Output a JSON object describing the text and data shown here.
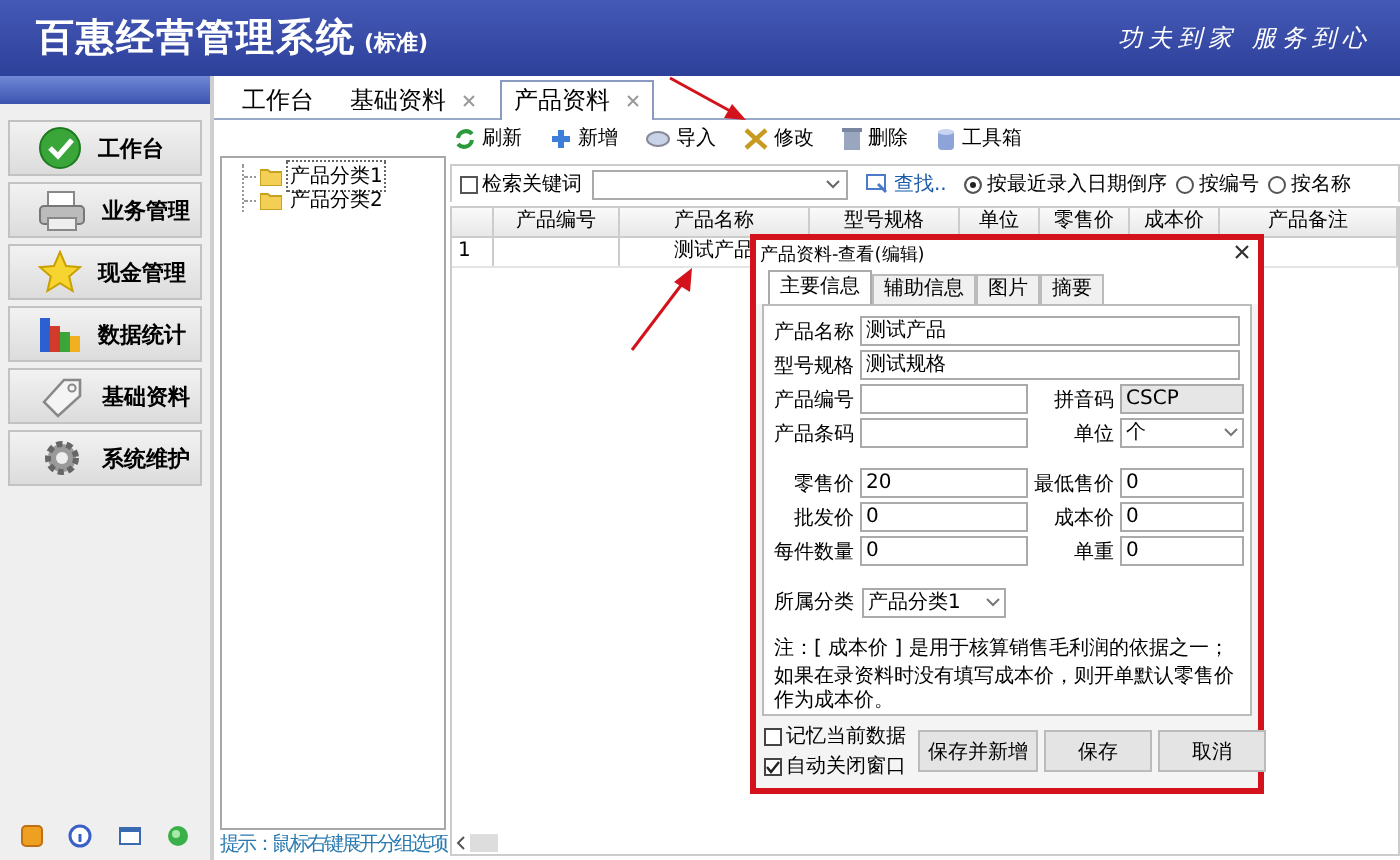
{
  "header": {
    "title": "百惠经营管理系统",
    "edition": "(标准)",
    "slogan": "功夫到家 服务到心"
  },
  "sidebar": {
    "items": [
      {
        "label": "工作台"
      },
      {
        "label": "业务管理"
      },
      {
        "label": "现金管理"
      },
      {
        "label": "数据统计"
      },
      {
        "label": "基础资料"
      },
      {
        "label": "系统维护"
      }
    ]
  },
  "tabs": [
    {
      "label": "工作台",
      "selected": false,
      "closable": false
    },
    {
      "label": "基础资料",
      "selected": false,
      "closable": true
    },
    {
      "label": "产品资料",
      "selected": true,
      "closable": true
    }
  ],
  "toolbar": [
    "刷新",
    "新增",
    "导入",
    "修改",
    "删除",
    "工具箱"
  ],
  "tree": {
    "items": [
      {
        "label": "产品分类1",
        "selected": true
      },
      {
        "label": "产品分类2",
        "selected": false
      }
    ],
    "hint": "提示：鼠标右键展开分组选项"
  },
  "search": {
    "label": "检索关键词",
    "checked": false,
    "find": "查找..",
    "sort_options": [
      {
        "label": "按最近录入日期倒序",
        "selected": true
      },
      {
        "label": "按编号",
        "selected": false
      },
      {
        "label": "按名称",
        "selected": false
      }
    ]
  },
  "table": {
    "columns": [
      "产品编号",
      "产品名称",
      "型号规格",
      "单位",
      "零售价",
      "成本价",
      "产品备注"
    ],
    "rows": [
      {
        "index": "1",
        "product_name": "测试产品"
      }
    ]
  },
  "dialog": {
    "title": "产品资料-查看(编辑)",
    "tabs": [
      {
        "label": "主要信息",
        "selected": true
      },
      {
        "label": "辅助信息",
        "selected": false
      },
      {
        "label": "图片",
        "selected": false
      },
      {
        "label": "摘要",
        "selected": false
      }
    ],
    "name_fields": [
      {
        "label": "产品名称",
        "value": "测试产品"
      },
      {
        "label": "型号规格",
        "value": "测试规格"
      }
    ],
    "code_fields": [
      {
        "label": "产品编号",
        "kind": "text",
        "disabled": false
      },
      {
        "label": "拼音码",
        "value": "CSCP",
        "kind": "text",
        "disabled": true
      },
      {
        "label": "产品条码",
        "kind": "text",
        "disabled": false
      },
      {
        "label": "单位",
        "value": "个",
        "kind": "select",
        "disabled": false
      }
    ],
    "price_fields": [
      {
        "label": "零售价",
        "value": "20",
        "kind": "text",
        "disabled": false
      },
      {
        "label": "最低售价",
        "value": "0",
        "kind": "text",
        "disabled": false
      },
      {
        "label": "批发价",
        "value": "0",
        "kind": "text",
        "disabled": false
      },
      {
        "label": "成本价",
        "value": "0",
        "kind": "text",
        "disabled": false
      },
      {
        "label": "每件数量",
        "value": "0",
        "kind": "text",
        "disabled": false
      },
      {
        "label": "单重",
        "value": "0",
        "kind": "text",
        "disabled": false
      }
    ],
    "category": {
      "label": "所属分类",
      "value": "产品分类1"
    },
    "note": [
      "注：[ 成本价 ] 是用于核算销售毛利润的依据之一；",
      "如果在录资料时没有填写成本价，则开单默认零售价作为成本价。"
    ],
    "options": [
      {
        "label": "记忆当前数据",
        "checked": false
      },
      {
        "label": "自动关闭窗口",
        "checked": true
      }
    ],
    "buttons": [
      "保存并新增",
      "保存",
      "取消"
    ]
  }
}
